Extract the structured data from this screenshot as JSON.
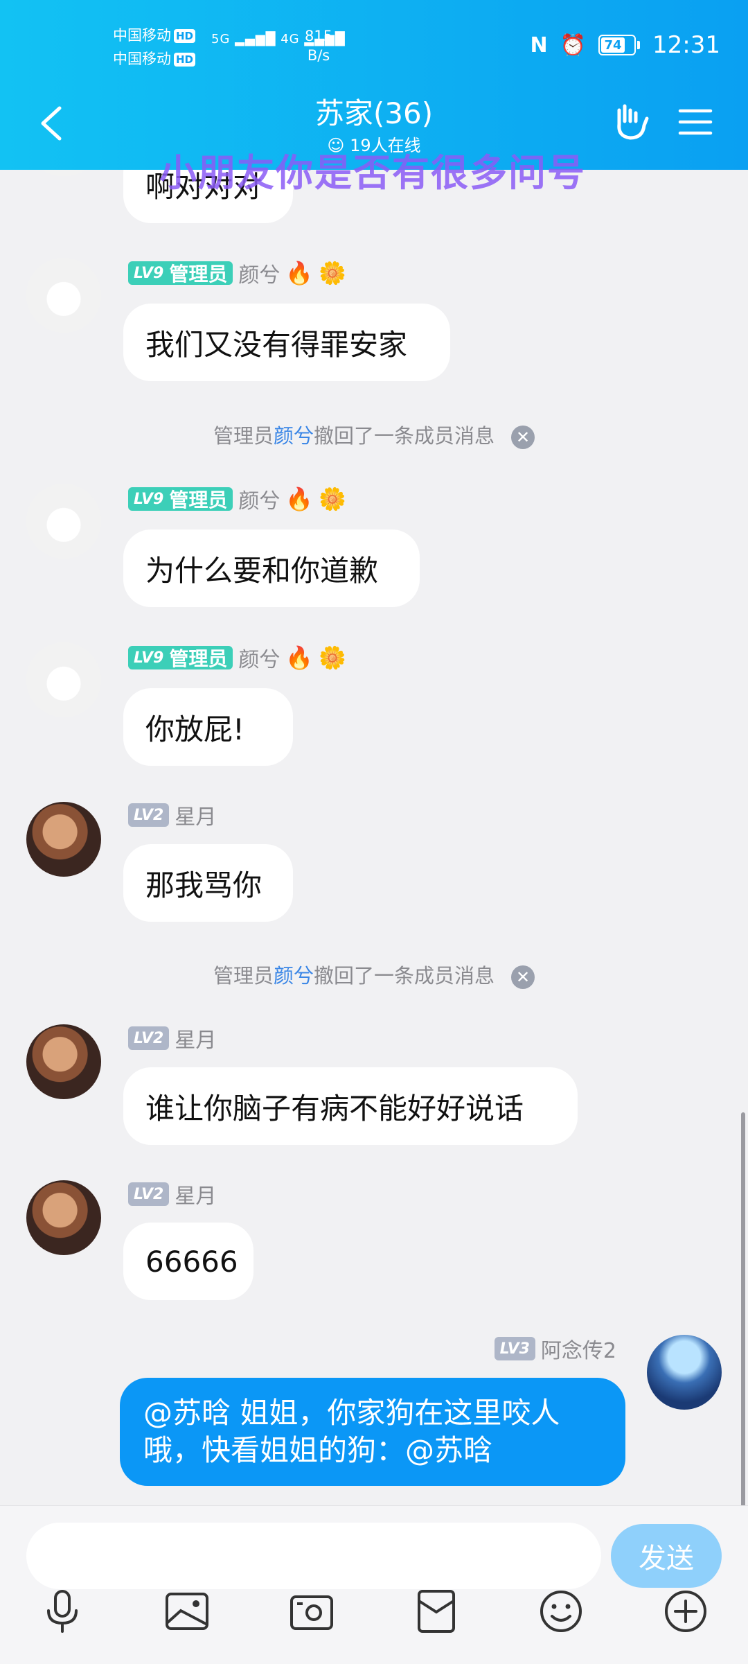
{
  "status_bar": {
    "carrier1": "中国移动",
    "carrier2": "中国移动",
    "hd": "HD",
    "signal1": "5G",
    "signal2": "4G",
    "speed_value": "815",
    "speed_unit": "B/s",
    "battery": "74",
    "time": "12:31"
  },
  "header": {
    "title": "苏家(36)",
    "online": "19人在线",
    "overlay_banner": "小朋友你是否有很多问号"
  },
  "messages": [
    {
      "text": "啊对对对"
    },
    {
      "level": "LV9",
      "role": "管理员",
      "name": "颜兮",
      "text": "我们又没有得罪安家"
    },
    {
      "level": "LV9",
      "role": "管理员",
      "name": "颜兮",
      "text": "为什么要和你道歉"
    },
    {
      "level": "LV9",
      "role": "管理员",
      "name": "颜兮",
      "text": "你放屁!"
    },
    {
      "level": "LV2",
      "name": "星月",
      "text": "那我骂你"
    },
    {
      "level": "LV2",
      "name": "星月",
      "text": "谁让你脑子有病不能好好说话"
    },
    {
      "level": "LV2",
      "name": "星月",
      "text": "66666"
    }
  ],
  "system_notice": {
    "prefix": "管理员",
    "name": "颜兮",
    "suffix": "撤回了一条成员消息"
  },
  "my_message": {
    "level": "LV3",
    "name": "阿念传2",
    "text": "@苏晗 姐姐，你家狗在这里咬人哦，快看姐姐的狗：@苏晗"
  },
  "input": {
    "send_label": "发送"
  },
  "colors": {
    "header": "#0aa0f2",
    "my_bubble": "#0b97f6",
    "admin_badge": "#3ccfb8",
    "low_badge": "#aeb6c8",
    "link": "#3a86e6"
  },
  "toolbar_icons": [
    "microphone-icon",
    "image-icon",
    "camera-icon",
    "red-packet-icon",
    "emoji-icon",
    "plus-icon"
  ]
}
